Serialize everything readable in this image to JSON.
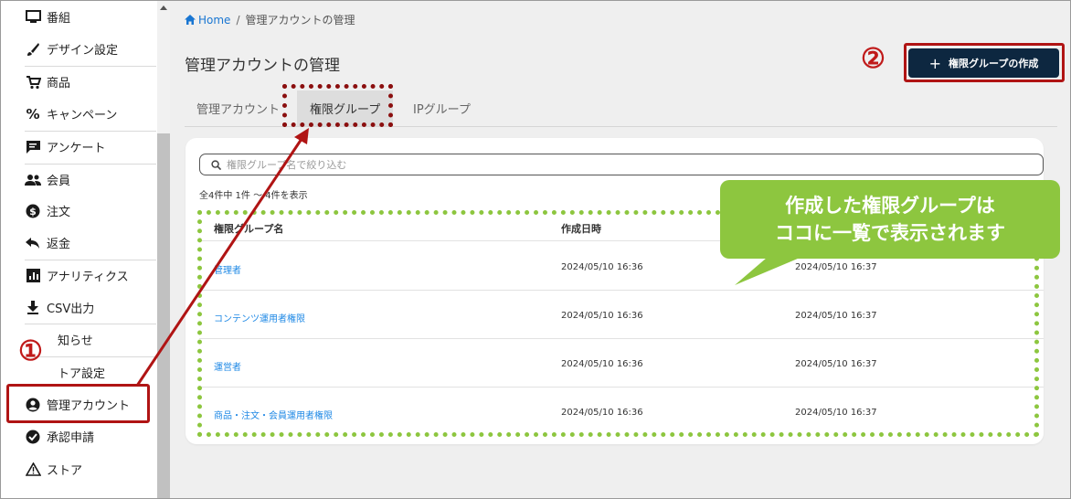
{
  "sidebar": {
    "items": [
      {
        "label": "番組",
        "icon": "monitor-icon"
      },
      {
        "label": "デザイン設定",
        "icon": "brush-icon"
      },
      {
        "label": "商品",
        "icon": "cart-icon"
      },
      {
        "label": "キャンペーン",
        "icon": "percent-icon"
      },
      {
        "label": "アンケート",
        "icon": "feedback-icon"
      },
      {
        "label": "会員",
        "icon": "people-icon"
      },
      {
        "label": "注文",
        "icon": "dollar-icon"
      },
      {
        "label": "返金",
        "icon": "reply-icon"
      },
      {
        "label": "アナリティクス",
        "icon": "analytics-icon"
      },
      {
        "label": "CSV出力",
        "icon": "download-icon"
      },
      {
        "label": "知らせ",
        "icon": ""
      },
      {
        "label": "トア設定",
        "icon": ""
      },
      {
        "label": "管理アカウント",
        "icon": "account-circle-icon"
      },
      {
        "label": "承認申請",
        "icon": "check-circle-icon"
      },
      {
        "label": "ストア",
        "icon": "warning-icon"
      }
    ]
  },
  "breadcrumb": {
    "home": "Home",
    "separator": "/",
    "current": "管理アカウントの管理"
  },
  "page": {
    "title": "管理アカウントの管理"
  },
  "toolbar": {
    "create_label": "権限グループの作成"
  },
  "tabs": [
    {
      "label": "管理アカウント",
      "active": false
    },
    {
      "label": "権限グループ",
      "active": true
    },
    {
      "label": "IPグループ",
      "active": false
    }
  ],
  "search": {
    "placeholder": "権限グループ名で絞り込む"
  },
  "list": {
    "count_text": "全4件中 1件 ～ 4件を表示"
  },
  "table": {
    "columns": [
      "権限グループ名",
      "作成日時",
      ""
    ],
    "rows": [
      {
        "name": "管理者",
        "created": "2024/05/10 16:36",
        "updated": "2024/05/10 16:37"
      },
      {
        "name": "コンテンツ運用者権限",
        "created": "2024/05/10 16:36",
        "updated": "2024/05/10 16:37"
      },
      {
        "name": "運営者",
        "created": "2024/05/10 16:36",
        "updated": "2024/05/10 16:37"
      },
      {
        "name": "商品・注文・会員運用者権限",
        "created": "2024/05/10 16:36",
        "updated": "2024/05/10 16:37"
      }
    ]
  },
  "annotations": {
    "marker1": "①",
    "marker2": "②",
    "callout_line1": "作成した権限グループは",
    "callout_line2": "ココに一覧で表示されます"
  },
  "colors": {
    "accent_blue": "#1976d2",
    "button_dark": "#0d2740",
    "annotation_red": "#b01414",
    "callout_green": "#8dc63f"
  }
}
